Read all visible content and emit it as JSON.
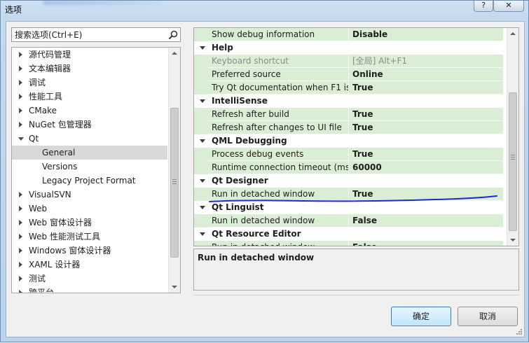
{
  "window": {
    "title": "选项"
  },
  "titlebar": {
    "help_label": "?",
    "close_label": "✕"
  },
  "search": {
    "placeholder": "搜索选项(Ctrl+E)"
  },
  "tree": {
    "items": [
      {
        "label": "源代码管理",
        "expanded": false
      },
      {
        "label": "文本编辑器",
        "expanded": false
      },
      {
        "label": "调试",
        "expanded": false
      },
      {
        "label": "性能工具",
        "expanded": false
      },
      {
        "label": "CMake",
        "expanded": false
      },
      {
        "label": "NuGet 包管理器",
        "expanded": false
      },
      {
        "label": "Qt",
        "expanded": true
      },
      {
        "label": "General",
        "child": true,
        "selected": true
      },
      {
        "label": "Versions",
        "child": true
      },
      {
        "label": "Legacy Project Format",
        "child": true
      },
      {
        "label": "VisualSVN",
        "expanded": false
      },
      {
        "label": "Web",
        "expanded": false
      },
      {
        "label": "Web 窗体设计器",
        "expanded": false
      },
      {
        "label": "Web 性能测试工具",
        "expanded": false
      },
      {
        "label": "Windows 窗体设计器",
        "expanded": false
      },
      {
        "label": "XAML 设计器",
        "expanded": false
      },
      {
        "label": "测试",
        "expanded": false
      },
      {
        "label": "跨平台",
        "expanded": false
      }
    ]
  },
  "grid": {
    "rows": [
      {
        "type": "prop",
        "name": "Show debug information",
        "value": "Disable"
      },
      {
        "type": "cat",
        "name": "Help"
      },
      {
        "type": "prop",
        "name": "Keyboard shortcut",
        "value": "[全局] Alt+F1",
        "disabled": true
      },
      {
        "type": "prop",
        "name": "Preferred source",
        "value": "Online"
      },
      {
        "type": "prop",
        "name": "Try Qt documentation when F1 is",
        "value": "True"
      },
      {
        "type": "cat",
        "name": "IntelliSense"
      },
      {
        "type": "prop",
        "name": "Refresh after build",
        "value": "True"
      },
      {
        "type": "prop",
        "name": "Refresh after changes to UI file",
        "value": "True"
      },
      {
        "type": "cat",
        "name": "QML Debugging"
      },
      {
        "type": "prop",
        "name": "Process debug events",
        "value": "True"
      },
      {
        "type": "prop",
        "name": "Runtime connection timeout (mse",
        "value": "60000"
      },
      {
        "type": "cat",
        "name": "Qt Designer"
      },
      {
        "type": "prop",
        "name": "Run in detached window",
        "value": "True"
      },
      {
        "type": "cat",
        "name": "Qt Linguist"
      },
      {
        "type": "prop",
        "name": "Run in detached window",
        "value": "False"
      },
      {
        "type": "cat",
        "name": "Qt Resource Editor"
      },
      {
        "type": "prop",
        "name": "Run in detached window",
        "value": "False"
      }
    ]
  },
  "description": {
    "title": "Run in detached window"
  },
  "buttons": {
    "ok": "确定",
    "cancel": "取消"
  },
  "colors": {
    "grid_row": "#d9eed4",
    "annotation": "#1a2bd0",
    "default_button_border": "#3c7fb1"
  }
}
